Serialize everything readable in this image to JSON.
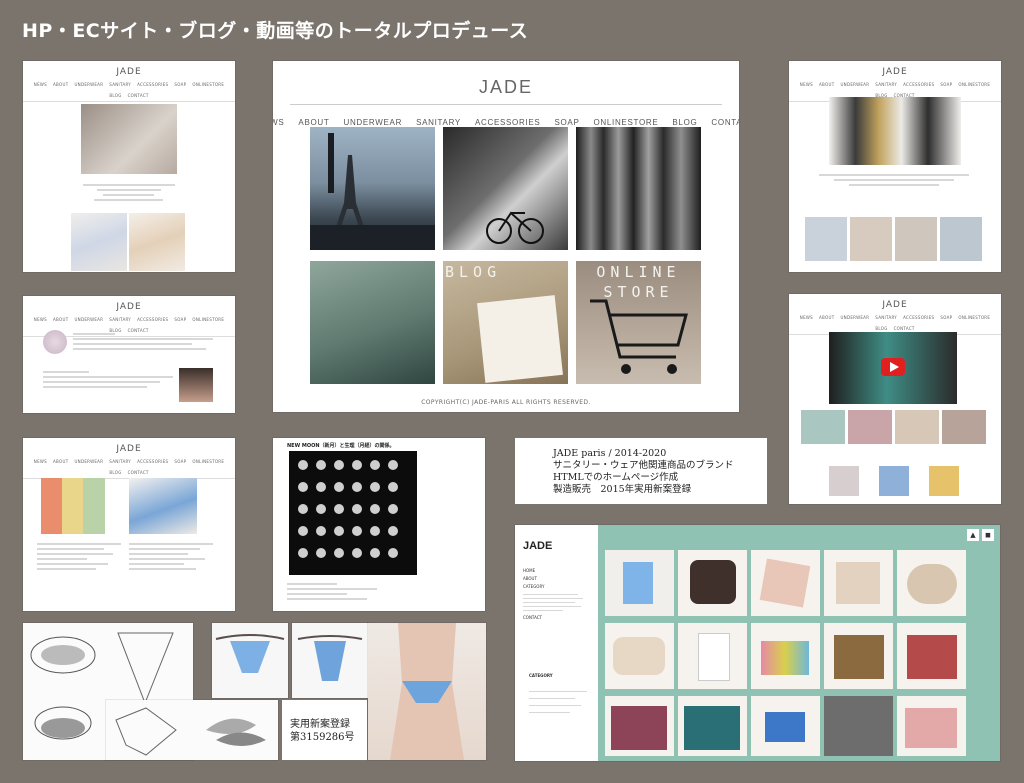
{
  "heading": "HP・ECサイト・ブログ・動画等のトータルプロデュース",
  "site": {
    "logo": "JADE",
    "nav": [
      "NEWS",
      "ABOUT",
      "UNDERWEAR",
      "SANITARY",
      "ACCESSORIES",
      "SOAP",
      "ONLINESTORE",
      "BLOG",
      "CONTACT"
    ],
    "tile_labels": {
      "blog": "BLOG",
      "store_line1": "ONLINE",
      "store_line2": "STORE"
    },
    "copyright": "COPYRIGHT(C) JADE-PARIS ALL RIGHTS RESERVED."
  },
  "moon_panel": {
    "title": "NEW MOON（新月）と生理（月経）の関係。"
  },
  "info_card": {
    "lines": [
      "JADE paris / 2014-2020",
      "サニタリー・ウェア他関連商品のブランド",
      "HTMLでのホームページ作成",
      "製造販売　2015年実用新案登録"
    ]
  },
  "patent_card": {
    "lines": [
      "実用新案登録",
      "第3159286号"
    ]
  },
  "shop": {
    "logo": "JADE",
    "menu": [
      "HOME",
      "ABOUT",
      "CATEGORY",
      "CONTACT"
    ],
    "category_heading": "CATEGORY"
  },
  "colors": {
    "background": "#7b746d",
    "shop_accent": "#8fc2b3"
  }
}
